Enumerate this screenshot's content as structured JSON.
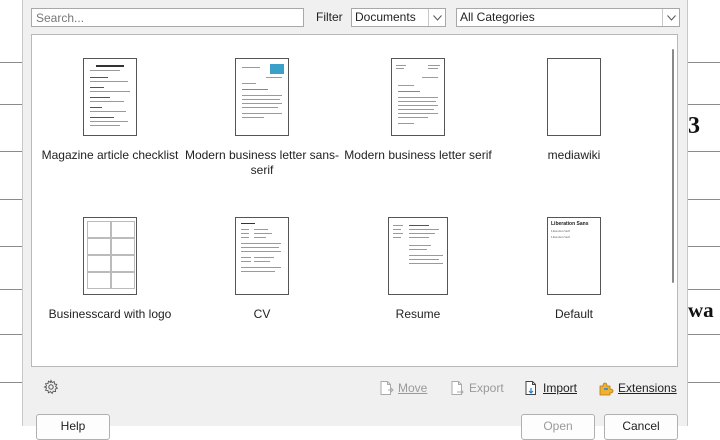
{
  "search": {
    "placeholder": "Search..."
  },
  "filter": {
    "label": "Filter",
    "type_value": "Documents",
    "category_value": "All Categories"
  },
  "templates": [
    {
      "label": "Magazine article checklist"
    },
    {
      "label": "Modern business letter sans-serif"
    },
    {
      "label": "Modern business letter serif"
    },
    {
      "label": "mediawiki"
    },
    {
      "label": "Businesscard with logo"
    },
    {
      "label": "CV"
    },
    {
      "label": "Resume"
    },
    {
      "label": "Default"
    }
  ],
  "default_thumb": {
    "title": "Liberation Sans",
    "line1": "Liberation Serif",
    "line2": "Liberation Serif"
  },
  "toolbar": {
    "move": "Move",
    "export": "Export",
    "import": "Import",
    "extensions": "Extensions"
  },
  "buttons": {
    "help": "Help",
    "open": "Open",
    "cancel": "Cancel"
  },
  "background_glyphs": {
    "b": "3",
    "wa": "wa"
  }
}
